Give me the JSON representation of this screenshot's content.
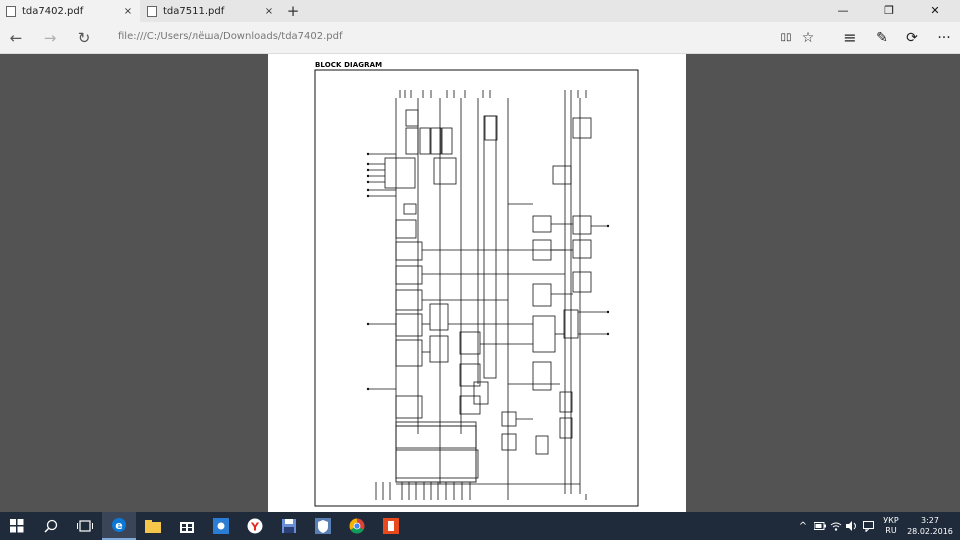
{
  "tabs": [
    {
      "title": "tda7402.pdf",
      "close": "×",
      "active": true
    },
    {
      "title": "tda7511.pdf",
      "close": "×",
      "active": false
    }
  ],
  "new_tab_label": "+",
  "window_controls": {
    "minimize": "—",
    "maximize": "❐",
    "close": "✕"
  },
  "address_bar": {
    "url": "file:///C:/Users/лёша/Downloads/tda7402.pdf"
  },
  "nav": {
    "back": "←",
    "forward": "→",
    "refresh": "↻"
  },
  "toolbar_icons": [
    "reading-view-icon",
    "favorites-star-icon",
    "hub-icon",
    "web-note-icon",
    "share-icon",
    "more-icon"
  ],
  "toolbar_glyphs": {
    "reading": "▯▯",
    "star": "☆",
    "hub": "≡",
    "note": "✎",
    "share": "⟳",
    "more": "···"
  },
  "document": {
    "heading": "BLOCK DIAGRAM"
  },
  "taskbar": {
    "apps": [
      "start",
      "search",
      "task-view",
      "edge",
      "file-explorer",
      "store",
      "weather",
      "yandex-browser",
      "save",
      "app-shield",
      "chrome",
      "app-orange"
    ]
  },
  "tray": {
    "language_top": "УКР",
    "language_bottom": "RU",
    "time": "3:27",
    "date": "28.02.2016",
    "chevron": "^"
  },
  "colors": {
    "tabbar_bg": "#e6e6e6",
    "toolbar_bg": "#f2f2f2",
    "viewer_bg": "#535353",
    "taskbar_bg": "#1f2a3a",
    "edge_blue": "#0b78d7",
    "chrome_red": "#db4437",
    "yandex_red": "#e42a1c"
  }
}
